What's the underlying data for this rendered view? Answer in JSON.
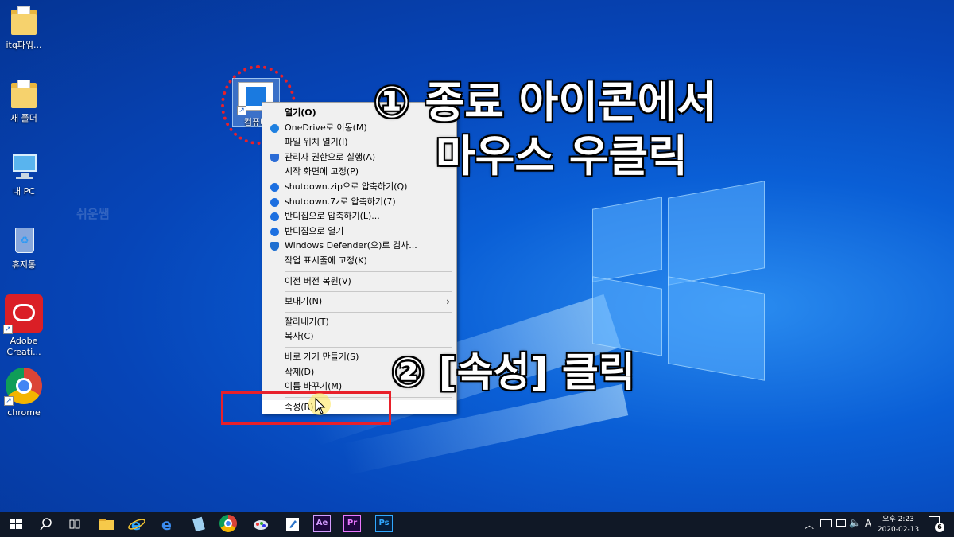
{
  "desktop": {
    "watermark": "쉬운쌤",
    "icons": [
      {
        "label": "itq파워...",
        "icon": "folder-icon"
      },
      {
        "label": "새 폴더",
        "icon": "folder-icon"
      },
      {
        "label": "내 PC",
        "icon": "pc-icon"
      },
      {
        "label": "휴지통",
        "icon": "recycle-bin-icon"
      },
      {
        "label": "Adobe Creati...",
        "icon": "adobe-cc-icon"
      },
      {
        "label": "chrome",
        "icon": "chrome-icon"
      }
    ],
    "selected_icon": {
      "label": "컴퓨터",
      "icon": "shutdown-shortcut-icon"
    }
  },
  "annotations": {
    "step1_line1": "① 종료 아이콘에서",
    "step1_line2": "마우스 우클릭",
    "step2": "② [속성] 클릭"
  },
  "context_menu": {
    "items": [
      {
        "label": "열기(O)",
        "bold": true
      },
      {
        "label": "OneDrive로 이동(M)",
        "icon": "onedrive-icon"
      },
      {
        "label": "파일 위치 열기(I)"
      },
      {
        "label": "관리자 권한으로 실행(A)",
        "icon": "uac-shield-icon"
      },
      {
        "label": "시작 화면에 고정(P)"
      },
      {
        "label": "shutdown.zip으로 압축하기(Q)",
        "icon": "bandizip-icon"
      },
      {
        "label": "shutdown.7z로 압축하기(7)",
        "icon": "bandizip-icon"
      },
      {
        "label": "반디집으로 압축하기(L)...",
        "icon": "bandizip-icon"
      },
      {
        "label": "반디집으로 열기",
        "icon": "bandizip-icon"
      },
      {
        "label": "Windows Defender(으)로 검사...",
        "icon": "defender-icon"
      },
      {
        "label": "작업 표시줄에 고정(K)"
      },
      {
        "separator": true
      },
      {
        "label": "이전 버전 복원(V)"
      },
      {
        "separator": true
      },
      {
        "label": "보내기(N)",
        "submenu": true
      },
      {
        "separator": true
      },
      {
        "label": "잘라내기(T)"
      },
      {
        "label": "복사(C)"
      },
      {
        "separator": true
      },
      {
        "label": "바로 가기 만들기(S)"
      },
      {
        "label": "삭제(D)"
      },
      {
        "label": "이름 바꾸기(M)"
      },
      {
        "separator": true
      },
      {
        "label": "속성(R)",
        "hover": true
      }
    ]
  },
  "taskbar": {
    "apps": [
      "start-icon",
      "search-icon",
      "task-view-icon",
      "file-explorer-icon",
      "ie-icon",
      "edge-icon",
      "notepad-icon",
      "chrome-icon",
      "paint-icon",
      "editor-icon",
      "after-effects-icon",
      "premiere-icon",
      "photoshop-icon"
    ],
    "tray": {
      "ime": "A",
      "time": "오후 2:23",
      "date": "2020-02-13",
      "notifications": "6"
    }
  },
  "colors": {
    "desktop_blue": "#0a5fd6",
    "highlight_red": "#e8202a",
    "annotation_text": "#ffffff"
  }
}
